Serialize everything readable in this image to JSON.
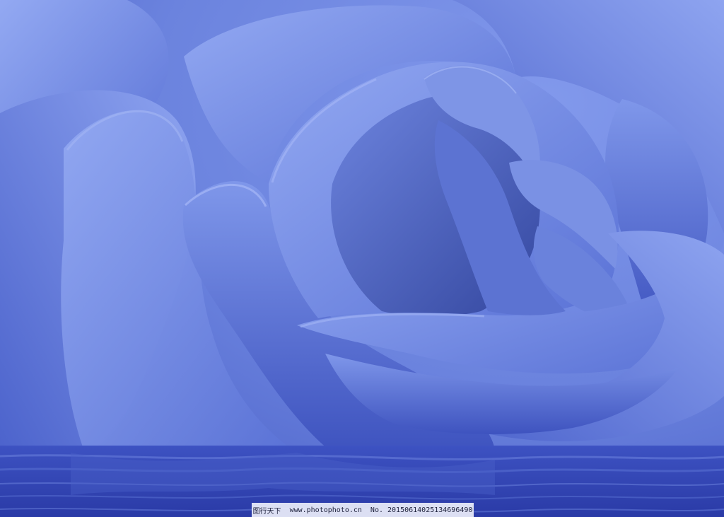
{
  "image": {
    "subject": "blue-rose-reflected-in-water",
    "palette": {
      "background": "#6f86e2",
      "petal_light": "#8aa2f0",
      "petal_mid": "#6d86e0",
      "petal_shadow": "#3a4fc0",
      "deep_shadow": "#26349a",
      "water": "#3347b8"
    }
  },
  "watermark": {
    "site_name": "图行天下",
    "url": "www.photophoto.cn",
    "number": "No. 20150614025134696490"
  }
}
